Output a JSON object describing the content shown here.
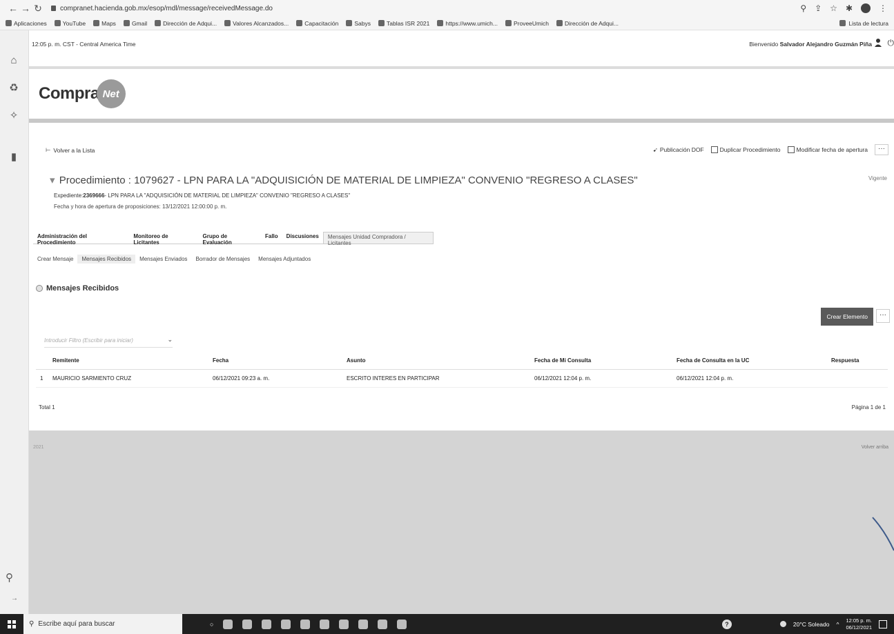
{
  "browser": {
    "url": "compranet.hacienda.gob.mx/esop/mdl/message/receivedMessage.do",
    "bookmarks": [
      "Aplicaciones",
      "YouTube",
      "Maps",
      "Gmail",
      "Dirección de Adqui...",
      "Valores Alcanzados...",
      "Capacitación",
      "Sabys",
      "Tablas ISR 2021",
      "https://www.umich...",
      "ProveeUmich",
      "Dirección de Adqui..."
    ],
    "reading_list": "Lista de lectura"
  },
  "header": {
    "time": "12:05 p. m. CST - Central America Time",
    "welcome_prefix": "Bienvenido",
    "user_name": "Salvador Alejandro Guzmán Piña",
    "logo_text": "Compra",
    "logo_globe_text": "Net"
  },
  "toolbar": {
    "back": "Volver a la Lista",
    "publicacion": "Publicación DOF",
    "duplicar": "Duplicar Procedimiento",
    "modificar": "Modificar fecha de apertura",
    "more": "···"
  },
  "procedure": {
    "title": "Procedimiento : 1079627 - LPN PARA LA \"ADQUISICIÓN DE MATERIAL DE LIMPIEZA\" CONVENIO \"REGRESO A CLASES\"",
    "status": "Vigente",
    "expediente_label": "Expediente:",
    "expediente_num": "2369666",
    "expediente_desc": "- LPN PARA LA \"ADQUISICIÓN DE MATERIAL DE LIMPIEZA\" CONVENIO \"REGRESO A CLASES\"",
    "fecha_apertura": "Fecha y hora de apertura de proposiciones: 13/12/2021 12:00:00 p. m."
  },
  "main_tabs": [
    "Administración del Procedimiento",
    "Monitoreo de Licitantes",
    "Grupo de Evaluación",
    "Fallo",
    "Discusiones",
    "Mensajes Unidad Compradora / Licitantes"
  ],
  "sub_tabs": [
    "Crear Mensaje",
    "Mensajes Recibidos",
    "Mensajes Enviados",
    "Borrador de Mensajes",
    "Mensajes Adjuntados"
  ],
  "section": {
    "title": "Mensajes Recibidos",
    "create_button": "Crear Elemento",
    "filter_placeholder": "Introducir Filtro (Escribir para iniciar)"
  },
  "table": {
    "columns": [
      "Remitente",
      "Fecha",
      "Asunto",
      "Fecha de Mi Consulta",
      "Fecha de Consulta en la UC",
      "Respuesta"
    ],
    "rows": [
      {
        "num": "1",
        "remitente": "MAURICIO SARMIENTO CRUZ",
        "fecha": "06/12/2021 09:23 a. m.",
        "asunto": "ESCRITO INTERES EN PARTICIPAR",
        "mi_consulta": "06/12/2021 12:04 p. m.",
        "consulta_uc": "06/12/2021 12:04 p. m.",
        "respuesta": ""
      }
    ],
    "total": "Total 1",
    "pagina": "Página 1 de 1"
  },
  "footer": {
    "left": "2021",
    "right": "Volver arriba"
  },
  "taskbar": {
    "search_placeholder": "Escribe aquí para buscar",
    "weather": "20°C Soleado",
    "time": "12:05 p. m.",
    "date": "06/12/2021"
  }
}
